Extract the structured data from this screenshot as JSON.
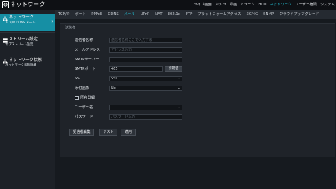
{
  "app": {
    "title": "ネットワーク",
    "logo_icon": "network-logo-icon"
  },
  "top_menu": [
    {
      "label": "ライブ画面",
      "active": false
    },
    {
      "label": "カメラ",
      "active": false
    },
    {
      "label": "録画",
      "active": false
    },
    {
      "label": "アラーム",
      "active": false
    },
    {
      "label": "HDD",
      "active": false
    },
    {
      "label": "ネットワーク",
      "active": true
    },
    {
      "label": "ユーザー権限",
      "active": false
    },
    {
      "label": "システム",
      "active": false
    }
  ],
  "sidebar": {
    "items": [
      {
        "title": "ネットワーク",
        "subtitle": "TCP/IP DDNS メール",
        "icon": "network-icon",
        "active": true
      },
      {
        "title": "ストリーム設定",
        "subtitle": "サブストリーム設定",
        "icon": "grid-icon",
        "active": false
      },
      {
        "title": "ネットワーク状態",
        "subtitle": "ネットワーク状態詳細",
        "icon": "network-status-icon",
        "active": false
      }
    ]
  },
  "tabs": [
    {
      "label": "TCP/IP",
      "active": false
    },
    {
      "label": "ポート",
      "active": false
    },
    {
      "label": "PPPoE",
      "active": false
    },
    {
      "label": "DDNS",
      "active": false
    },
    {
      "label": "メール",
      "active": true
    },
    {
      "label": "UPnP",
      "active": false
    },
    {
      "label": "NAT",
      "active": false
    },
    {
      "label": "802.1x",
      "active": false
    },
    {
      "label": "FTP",
      "active": false
    },
    {
      "label": "プラットフォームアクセス",
      "active": false
    },
    {
      "label": "3G/4G",
      "active": false
    },
    {
      "label": "SNMP",
      "active": false
    },
    {
      "label": "クラウドアップグレード",
      "active": false
    }
  ],
  "form": {
    "section_title": "送信者",
    "sender_name": {
      "label": "送信者名称",
      "value": "",
      "placeholder": "送信者名称ここで入力する"
    },
    "email_address": {
      "label": "メールアドレス",
      "value": "",
      "placeholder": "アドレス入力"
    },
    "smtp_server": {
      "label": "SMTPサーバー",
      "value": ""
    },
    "smtp_port": {
      "label": "SMTPポート",
      "value": "465",
      "reset_label": "初期値"
    },
    "ssl": {
      "label": "SSL",
      "value": "SSL"
    },
    "attach_image": {
      "label": "添付画像",
      "value": "No"
    },
    "anonymous": {
      "label": "匿名登録",
      "checked": false
    },
    "username": {
      "label": "ユーザー名",
      "value": ""
    },
    "password": {
      "label": "パスワード",
      "value": "",
      "placeholder": "パスワード入力"
    }
  },
  "actions": {
    "receiver_label": "受信者編集",
    "test_label": "テスト",
    "apply_label": "適用"
  },
  "colors": {
    "accent": "#22b8cc",
    "sidebar_active": "#168fa4"
  }
}
